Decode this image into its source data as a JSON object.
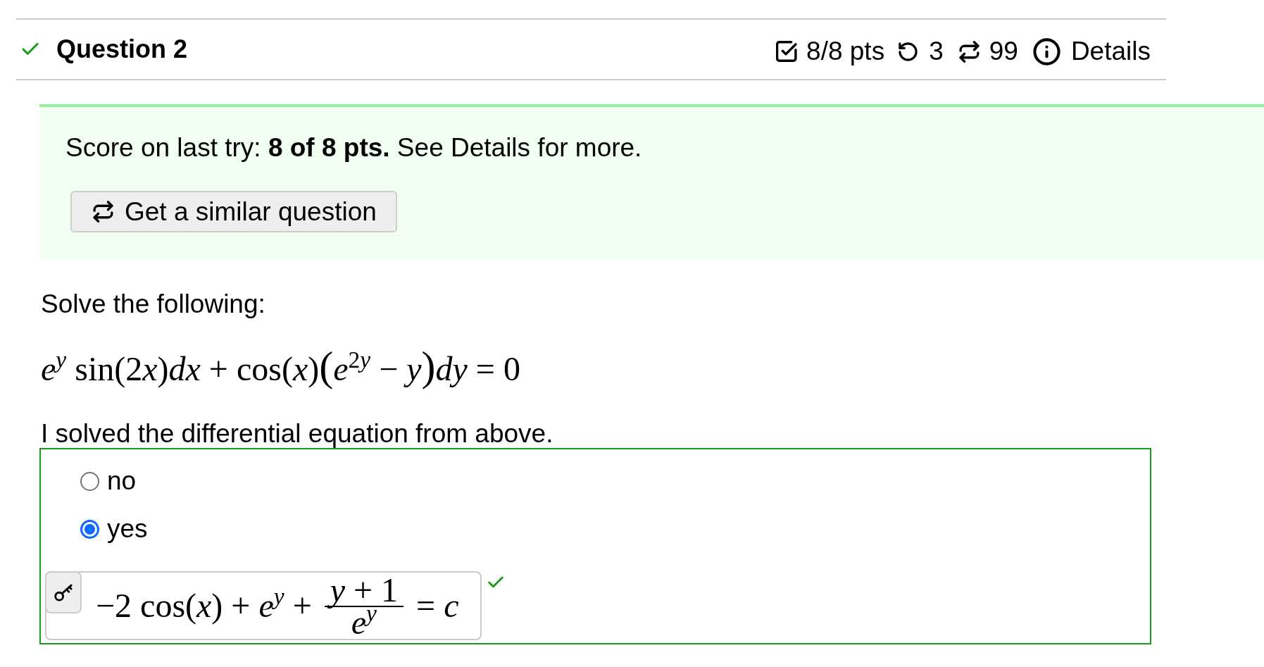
{
  "question": {
    "title": "Question 2",
    "correct": true,
    "score": "8/8 pts",
    "retries": "3",
    "variations": "99",
    "details": "Details"
  },
  "feedback": {
    "message": "Score on last try: **8 of 8 pts.** See Details for more.",
    "button": "Get a similar question"
  },
  "prompt": "Solve the following:",
  "equation": [
    {
      "kind": "var",
      "text": "e"
    },
    {
      "kind": "sup_var",
      "text": "y"
    },
    {
      "kind": "text",
      "text": " sin(2"
    },
    {
      "kind": "var",
      "text": "x"
    },
    {
      "kind": "text",
      "text": ")"
    },
    {
      "kind": "var",
      "text": "dx"
    },
    {
      "kind": "text",
      "text": " + cos("
    },
    {
      "kind": "var",
      "text": "x"
    },
    {
      "kind": "text",
      "text": ")"
    },
    {
      "kind": "big",
      "text": "("
    },
    {
      "kind": "var",
      "text": "e"
    },
    {
      "kind": "sup",
      "text": "2"
    },
    {
      "kind": "sup_var",
      "text": "y"
    },
    {
      "kind": "text",
      "text": " − "
    },
    {
      "kind": "var",
      "text": "y"
    },
    {
      "kind": "big",
      "text": ")"
    },
    {
      "kind": "var",
      "text": "dy"
    },
    {
      "kind": "text",
      "text": " = 0"
    }
  ],
  "statement": "I solved the differential equation from above.",
  "answer": {
    "options": [
      {
        "label": "no",
        "selected": false
      },
      {
        "label": "yes",
        "selected": true
      }
    ],
    "correct": true,
    "expression": [
      {
        "kind": "math",
        "tokens": [
          {
            "kind": "text",
            "text": "−2 cos("
          },
          {
            "kind": "var",
            "text": "x"
          },
          {
            "kind": "text",
            "text": ") + "
          },
          {
            "kind": "var",
            "text": "e"
          },
          {
            "kind": "sup_var",
            "text": "y"
          },
          {
            "kind": "text",
            "text": " +"
          }
        ]
      },
      {
        "kind": "fraction",
        "numerator": [
          {
            "kind": "var",
            "text": "y"
          },
          {
            "kind": "text",
            "text": " + 1"
          }
        ],
        "denominator": [
          {
            "kind": "var",
            "text": "e"
          },
          {
            "kind": "sup_var",
            "text": "y"
          }
        ]
      },
      {
        "kind": "math",
        "tokens": [
          {
            "kind": "text",
            "text": "= "
          },
          {
            "kind": "var",
            "text": "c"
          }
        ]
      }
    ]
  }
}
